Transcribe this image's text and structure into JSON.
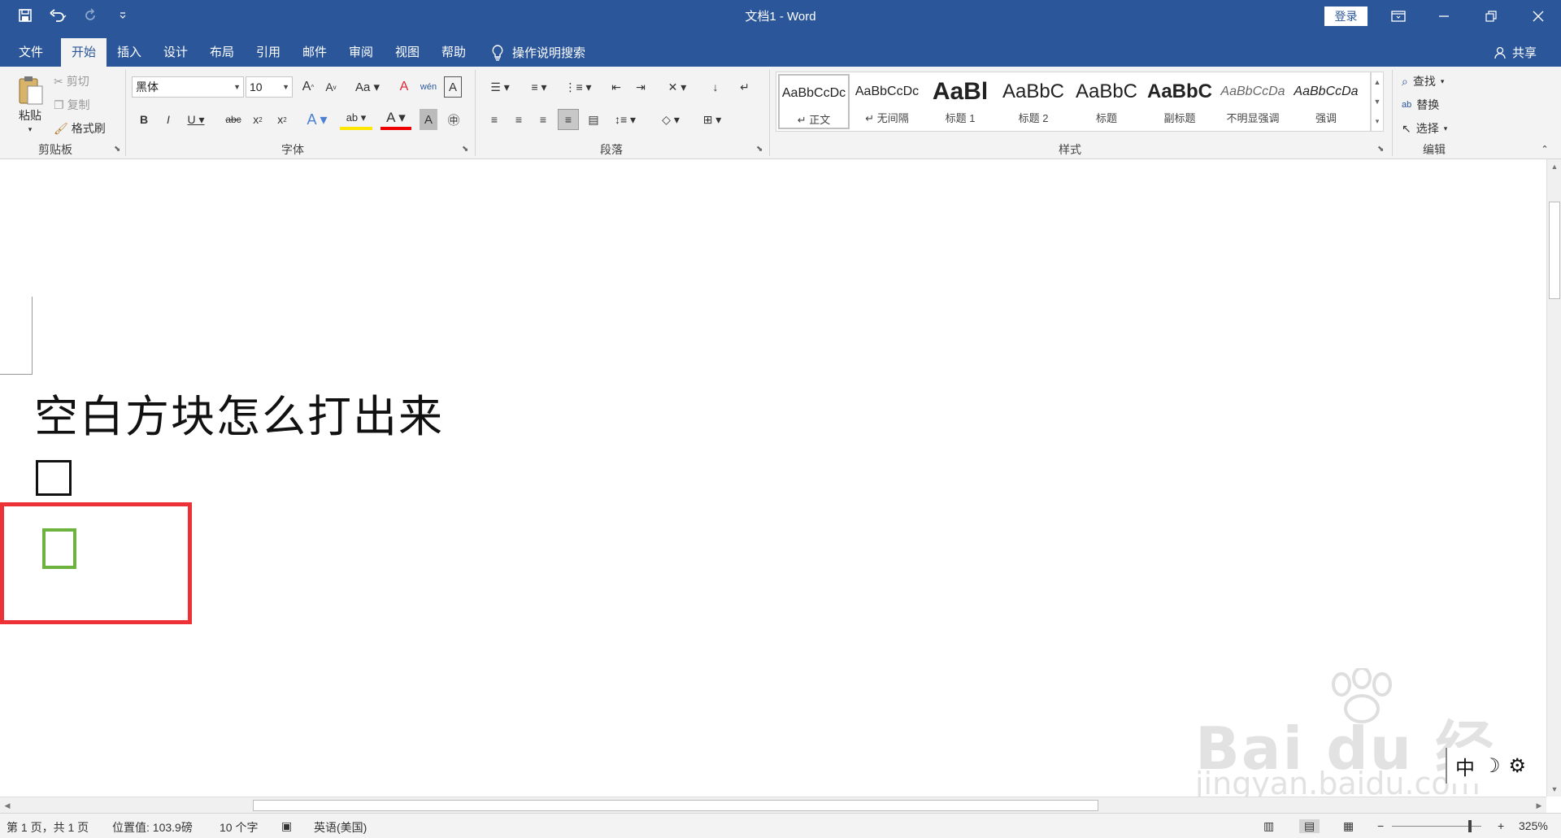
{
  "window": {
    "title": "文档1 - Word",
    "login_label": "登录"
  },
  "tabs": [
    {
      "label": "文件"
    },
    {
      "label": "开始"
    },
    {
      "label": "插入"
    },
    {
      "label": "设计"
    },
    {
      "label": "布局"
    },
    {
      "label": "引用"
    },
    {
      "label": "邮件"
    },
    {
      "label": "审阅"
    },
    {
      "label": "视图"
    },
    {
      "label": "帮助"
    }
  ],
  "tell_me": "操作说明搜索",
  "share_label": "共享",
  "clipboard": {
    "paste": "粘贴",
    "cut": "剪切",
    "copy": "复制",
    "format_painter": "格式刷",
    "group_label": "剪贴板"
  },
  "font": {
    "name": "黑体",
    "size": "10",
    "group_label": "字体"
  },
  "paragraph": {
    "group_label": "段落"
  },
  "styles": {
    "group_label": "样式",
    "items": [
      {
        "preview": "AaBbCcDc",
        "name": "↵ 正文"
      },
      {
        "preview": "AaBbCcDc",
        "name": "↵ 无间隔"
      },
      {
        "preview": "AaBl",
        "name": "标题 1"
      },
      {
        "preview": "AaBbC",
        "name": "标题 2"
      },
      {
        "preview": "AaBbC",
        "name": "标题"
      },
      {
        "preview": "AaBbC",
        "name": "副标题"
      },
      {
        "preview": "AaBbCcDa",
        "name": "不明显强调"
      },
      {
        "preview": "AaBbCcDa",
        "name": "强调"
      }
    ]
  },
  "editing": {
    "find": "查找",
    "replace": "替换",
    "select": "选择",
    "group_label": "编辑"
  },
  "document": {
    "heading": "空白方块怎么打出来"
  },
  "statusbar": {
    "page": "第 1 页，共 1 页",
    "position": "位置值: 103.9磅",
    "word_count": "10 个字",
    "language": "英语(美国)",
    "zoom": "325%"
  },
  "watermark": {
    "brand": "Bai du 经验",
    "url": "jingyan.baidu.com"
  },
  "ime": {
    "mode": "中"
  },
  "colors": {
    "title_bar": "#2b579a",
    "highlight_box": "#ec3237",
    "green_square": "#6eb33f"
  }
}
